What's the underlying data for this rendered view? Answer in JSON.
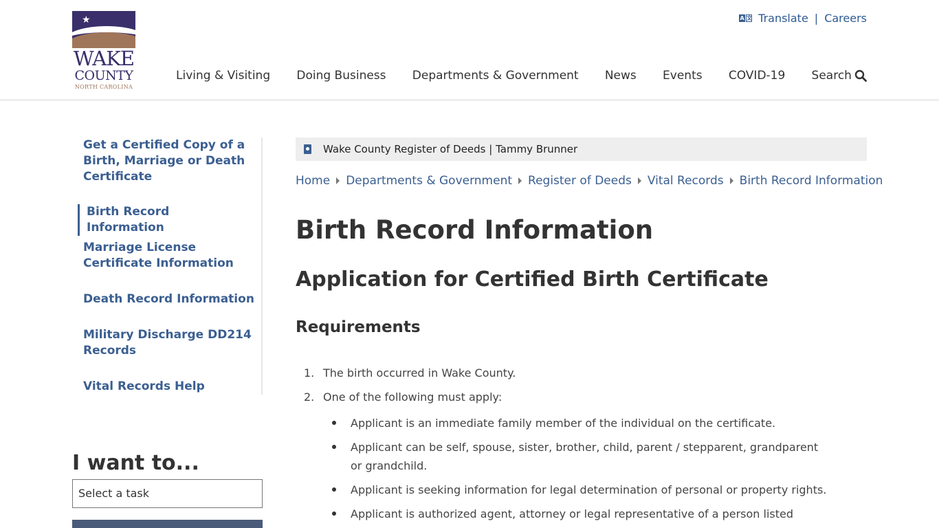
{
  "logo": {
    "star": "★",
    "line1": "WAKE",
    "line2": "COUNTY",
    "line3": "NORTH CAROLINA"
  },
  "utility": {
    "translate_icon_a": "A",
    "translate_icon_b": "文",
    "translate": "Translate",
    "separator": "|",
    "careers": "Careers"
  },
  "nav": {
    "items": [
      "Living & Visiting",
      "Doing Business",
      "Departments & Government",
      "News",
      "Events",
      "COVID-19"
    ],
    "search_label": "Search"
  },
  "sidebar": {
    "items": [
      "Get a Certified Copy of a Birth, Marriage or Death Certificate",
      "Birth Record Information",
      "Marriage License Certificate Information",
      "Death Record Information",
      "Military Discharge DD214 Records",
      "Vital Records Help"
    ],
    "active_index": 1
  },
  "iwant": {
    "title": "I want to...",
    "placeholder": "Select a task"
  },
  "agency_bar": {
    "text": "Wake County Register of Deeds | Tammy Brunner"
  },
  "breadcrumb": [
    "Home",
    "Departments & Government",
    "Register of Deeds",
    "Vital Records",
    "Birth Record Information"
  ],
  "main": {
    "title": "Birth Record Information",
    "subtitle": "Application for Certified Birth Certificate",
    "requirements_title": "Requirements",
    "list": [
      {
        "num": "1.",
        "text": "The birth occurred in Wake County."
      },
      {
        "num": "2.",
        "text": "One of the following must apply:"
      }
    ],
    "bullets": [
      "Applicant is an immediate family member of the individual on the certificate.",
      "Applicant can be self, spouse, sister, brother, child, parent / stepparent, grandparent or grandchild.",
      "Applicant is seeking information for legal determination of personal or property rights.",
      "Applicant is authorized agent, attorney or legal representative of a person listed above."
    ]
  },
  "colors": {
    "brand_purple": "#3a2f6b",
    "brand_tan": "#a0765a",
    "link_blue": "#3b5f91"
  }
}
